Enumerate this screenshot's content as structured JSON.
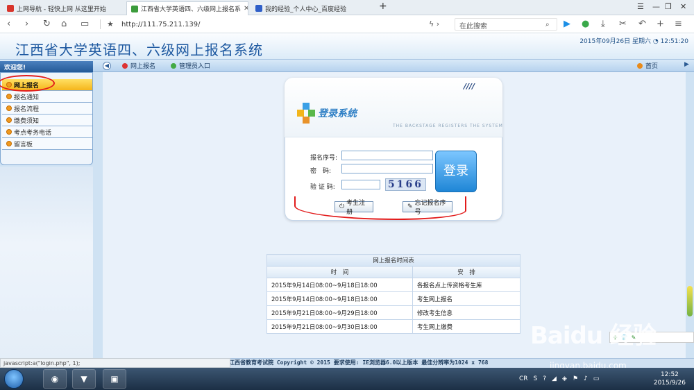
{
  "browser": {
    "tabs": [
      {
        "label": "上网导航 - 轻快上网 从这里开始",
        "active": false
      },
      {
        "label": "江西省大学英语四、六级网上报名系",
        "active": true
      },
      {
        "label": "我的经验_个人中心_百度经验",
        "active": false
      }
    ],
    "new_tab": "+",
    "url": "http://111.75.211.139/",
    "search_placeholder": "在此搜索"
  },
  "site": {
    "title": "江西省大学英语四、六级网上报名系统",
    "datetime": "2015年09月26日  星期六 ◔ 12:51:20"
  },
  "nav": {
    "online_signup": "网上报名",
    "admin_entry": "管理员入口",
    "home": "首页"
  },
  "sidebar": {
    "welcome": "欢迎您!",
    "items": [
      {
        "label": "网上报名",
        "selected": true
      },
      {
        "label": "报名通知",
        "selected": false
      },
      {
        "label": "报名流程",
        "selected": false
      },
      {
        "label": "缴费须知",
        "selected": false
      },
      {
        "label": "考点考务电话",
        "selected": false
      },
      {
        "label": "留言板",
        "selected": false
      }
    ]
  },
  "login": {
    "title": "登录系统",
    "subtitle": "THE BACKSTAGE REGISTERS THE SYSTEM",
    "badge": "////",
    "reg_no_label": "报名序号:",
    "password_label": "密　码:",
    "captcha_label": "验 证 码:",
    "captcha_text": "5166",
    "login_button": "登录",
    "register_button": "考生注册",
    "forgot_button": "忘记报名序号"
  },
  "schedule": {
    "caption": "网上报名时间表",
    "headers": [
      "时　间",
      "安　排"
    ],
    "rows": [
      [
        "2015年9月14日08:00~9月18日18:00",
        "各报名点上传资格考生库"
      ],
      [
        "2015年9月14日08:00~9月18日18:00",
        "考生网上报名"
      ],
      [
        "2015年9月21日08:00~9月29日18:00",
        "修改考生信息"
      ],
      [
        "2015年9月21日08:00~9月30日18:00",
        "考生网上缴费"
      ]
    ]
  },
  "footer": {
    "text": "江西省教育考试院 Copyright © 2015 要求使用: IE浏览器6.0以上版本 最佳分辨率为1024 x 768",
    "status": "javascript:a(\"login.php\", 1);"
  },
  "taskbar": {
    "tray": "CR",
    "time": "12:52",
    "date": "2015/9/26"
  },
  "watermark": {
    "brand": "Baidu 经验",
    "url": "jingyan.baidu.com"
  },
  "colors": {
    "accent": "#1d58a0",
    "selected_item": "#f5b51b",
    "annotation_red": "#e21b1b"
  }
}
